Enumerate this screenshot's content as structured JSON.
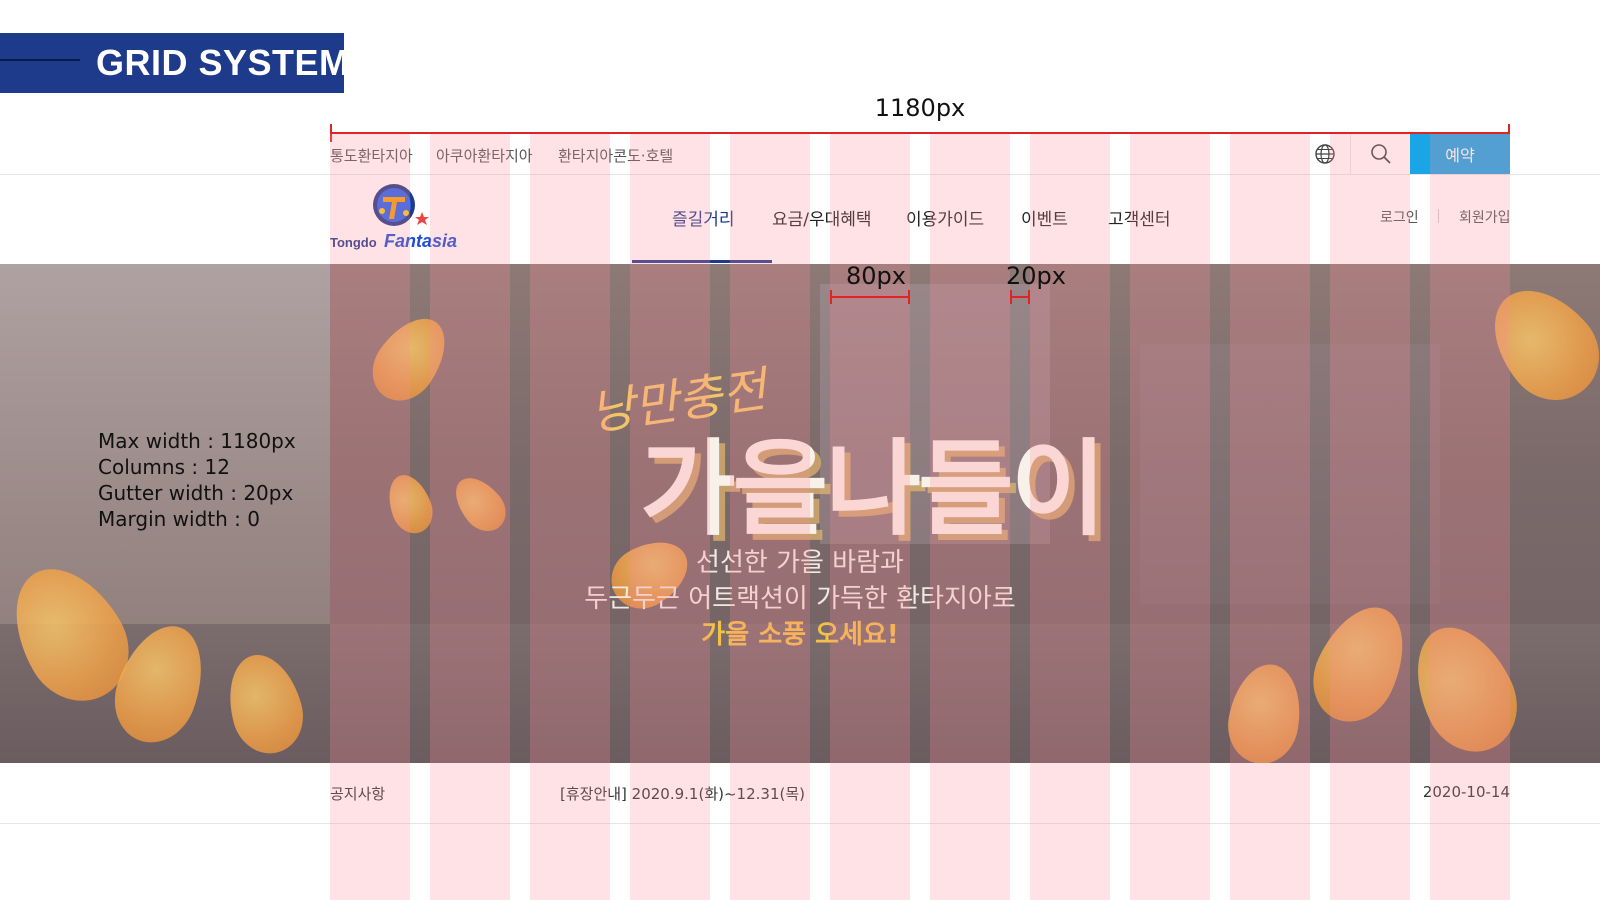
{
  "slide": {
    "title": "GRID SYSTEM",
    "width_label": "1180px"
  },
  "utility_bar": {
    "links": [
      "통도환타지아",
      "아쿠아환타지아",
      "환타지아콘도·호텔"
    ],
    "reserve_label": "예약",
    "globe_icon": "globe-icon",
    "search_icon": "search-icon"
  },
  "logo": {
    "text_tongdo": "Tongdo",
    "text_fantasia": "Fantasia"
  },
  "nav": {
    "items": [
      "즐길거리",
      "요금/우대혜택",
      "이용가이드",
      "이벤트",
      "고객센터"
    ],
    "active_index": 0,
    "login": "로그인",
    "join": "회원가입"
  },
  "hero": {
    "script": "낭만충전",
    "headline": "가을나들이",
    "sub1": "선선한 가을 바람과",
    "sub2": "두근두근 어트랙션이 가득한 환타지아로",
    "sub3": "가을 소풍 오세요!"
  },
  "grid_specs": {
    "lines": [
      "Max width : 1180px",
      "Columns : 12",
      "Gutter width : 20px",
      "Margin width : 0"
    ]
  },
  "measure": {
    "column_label": "80px",
    "gutter_label": "20px"
  },
  "notice": {
    "label": "공지사항",
    "text": "[휴장안내] 2020.9.1(화)~12.31(목)",
    "date": "2020-10-14"
  },
  "colors": {
    "brand_navy": "#1e3a8a",
    "reserve_blue": "#1aa6e5",
    "measure_red": "#e02424",
    "grid_pink": "rgba(255,140,150,0.25)",
    "accent_yellow": "#f5c047"
  }
}
